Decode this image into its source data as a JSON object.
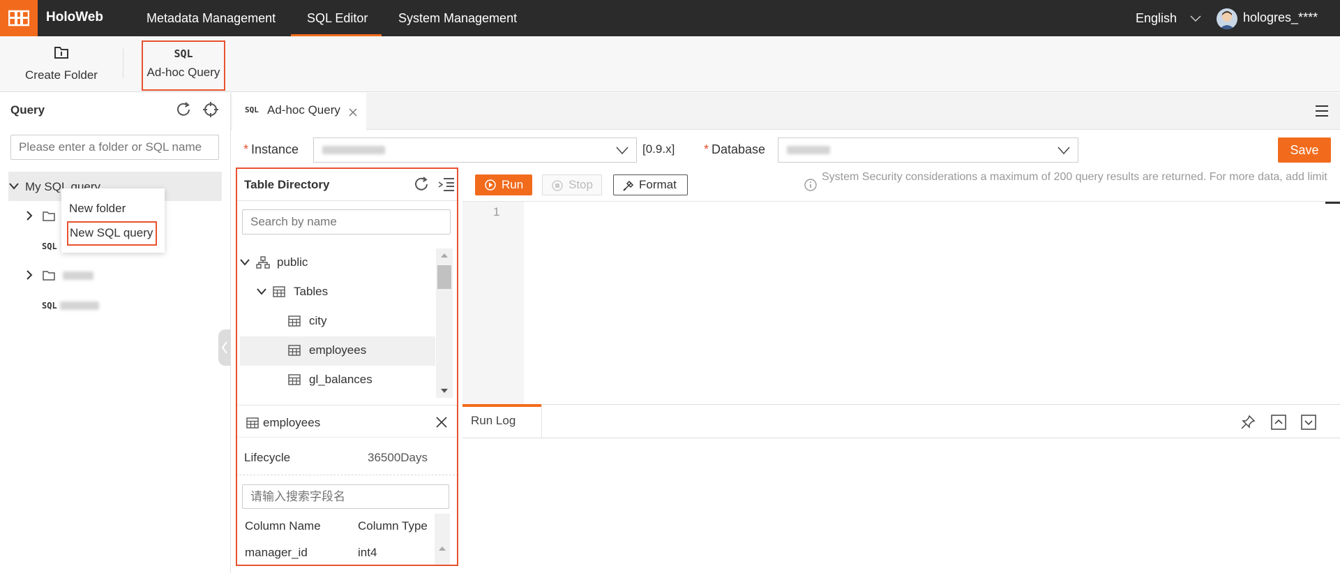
{
  "header": {
    "brand": "HoloWeb",
    "nav": [
      "Metadata Management",
      "SQL Editor",
      "System Management"
    ],
    "language": "English",
    "user": "hologres_****"
  },
  "toolbar": {
    "create_folder": "Create Folder",
    "adhoc_query": "Ad-hoc Query",
    "sql_icon_text": "SQL"
  },
  "sidebar": {
    "title": "Query",
    "search_placeholder": "Please enter a folder or SQL name",
    "root": "My SQL query",
    "sql_tag": "SQL"
  },
  "context_menu": {
    "new_folder": "New folder",
    "new_sql_query": "New SQL query"
  },
  "tab": {
    "icon_text": "SQL",
    "label": "Ad-hoc Query"
  },
  "form": {
    "instance_label": "Instance",
    "version": "[0.9.x]",
    "database_label": "Database",
    "save": "Save"
  },
  "directory": {
    "title": "Table Directory",
    "search_placeholder": "Search by name",
    "schema": "public",
    "group": "Tables",
    "tables": [
      "city",
      "employees",
      "gl_balances"
    ]
  },
  "details": {
    "table_name": "employees",
    "lifecycle_label": "Lifecycle",
    "lifecycle_value": "36500Days",
    "field_search_placeholder": "请输入搜索字段名",
    "col_name_header": "Column Name",
    "col_type_header": "Column Type",
    "rows": [
      {
        "name": "manager_id",
        "type": "int4"
      }
    ]
  },
  "editor": {
    "run": "Run",
    "stop": "Stop",
    "format": "Format",
    "notice": "System Security considerations a maximum of 200 query results are returned. For more data, add limit",
    "line_number": "1"
  },
  "runlog": {
    "tab": "Run Log"
  },
  "colors": {
    "accent": "#f26b1d",
    "topbar": "#2b2b2b",
    "highlight_box": "#e8522f"
  }
}
